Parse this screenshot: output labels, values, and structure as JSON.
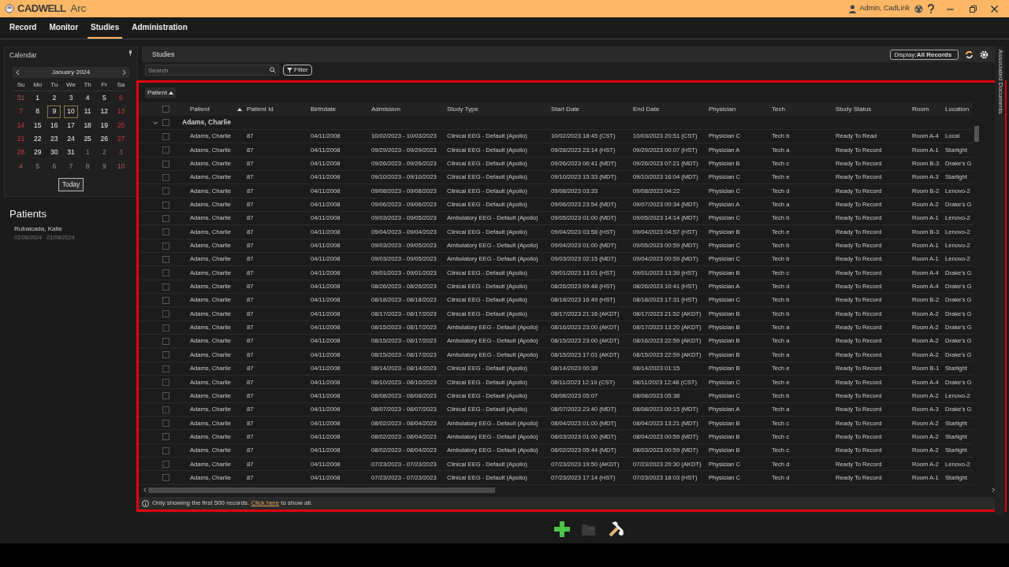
{
  "window": {
    "brand": "CADWELL",
    "product": "Arc",
    "user": "Admin, CadLink"
  },
  "menu": [
    {
      "label": "Record",
      "selected": false
    },
    {
      "label": "Monitor",
      "selected": false
    },
    {
      "label": "Studies",
      "selected": true
    },
    {
      "label": "Administration",
      "selected": false
    }
  ],
  "calendar": {
    "title": "Calendar",
    "month": "January 2024",
    "weekdays": [
      "Su",
      "Mo",
      "Tu",
      "We",
      "Th",
      "Fr",
      "Sa"
    ],
    "days": [
      {
        "d": "31",
        "in_month": false,
        "selected": false
      },
      {
        "d": "1",
        "in_month": true,
        "selected": false
      },
      {
        "d": "2",
        "in_month": true,
        "selected": false
      },
      {
        "d": "3",
        "in_month": true,
        "selected": false
      },
      {
        "d": "4",
        "in_month": true,
        "selected": false
      },
      {
        "d": "5",
        "in_month": true,
        "selected": false
      },
      {
        "d": "6",
        "in_month": true,
        "selected": false
      },
      {
        "d": "7",
        "in_month": true,
        "selected": false
      },
      {
        "d": "8",
        "in_month": true,
        "selected": false
      },
      {
        "d": "9",
        "in_month": true,
        "selected": true
      },
      {
        "d": "10",
        "in_month": true,
        "selected": true
      },
      {
        "d": "11",
        "in_month": true,
        "selected": false
      },
      {
        "d": "12",
        "in_month": true,
        "selected": false
      },
      {
        "d": "13",
        "in_month": true,
        "selected": false
      },
      {
        "d": "14",
        "in_month": true,
        "selected": false
      },
      {
        "d": "15",
        "in_month": true,
        "selected": false
      },
      {
        "d": "16",
        "in_month": true,
        "selected": false
      },
      {
        "d": "17",
        "in_month": true,
        "selected": false
      },
      {
        "d": "18",
        "in_month": true,
        "selected": false
      },
      {
        "d": "19",
        "in_month": true,
        "selected": false
      },
      {
        "d": "20",
        "in_month": true,
        "selected": false
      },
      {
        "d": "21",
        "in_month": true,
        "selected": false
      },
      {
        "d": "22",
        "in_month": true,
        "selected": false
      },
      {
        "d": "23",
        "in_month": true,
        "selected": false
      },
      {
        "d": "24",
        "in_month": true,
        "selected": false
      },
      {
        "d": "25",
        "in_month": true,
        "selected": false
      },
      {
        "d": "26",
        "in_month": true,
        "selected": false
      },
      {
        "d": "27",
        "in_month": true,
        "selected": false
      },
      {
        "d": "28",
        "in_month": true,
        "selected": false
      },
      {
        "d": "29",
        "in_month": true,
        "selected": false
      },
      {
        "d": "30",
        "in_month": true,
        "selected": false
      },
      {
        "d": "31",
        "in_month": true,
        "selected": false
      },
      {
        "d": "1",
        "in_month": false,
        "selected": false
      },
      {
        "d": "2",
        "in_month": false,
        "selected": false
      },
      {
        "d": "3",
        "in_month": false,
        "selected": false
      },
      {
        "d": "4",
        "in_month": false,
        "selected": false
      },
      {
        "d": "5",
        "in_month": false,
        "selected": false
      },
      {
        "d": "6",
        "in_month": false,
        "selected": false
      },
      {
        "d": "7",
        "in_month": false,
        "selected": false
      },
      {
        "d": "8",
        "in_month": false,
        "selected": false
      },
      {
        "d": "9",
        "in_month": false,
        "selected": false
      },
      {
        "d": "10",
        "in_month": false,
        "selected": false
      }
    ],
    "today_button": "Today"
  },
  "patients": {
    "title": "Patients",
    "items": [
      {
        "name": "Rubalcada, Katie",
        "dates": "01/09/2024 - 01/09/2024"
      }
    ]
  },
  "studies": {
    "title": "Studies",
    "search": {
      "placeholder": "Search"
    },
    "filter_button": "Filter",
    "display": {
      "label": "Display:",
      "value": "All Records"
    },
    "side_tab": "Associated Documents",
    "group_by": "Patient",
    "header_checked": false,
    "columns": [
      "Patient",
      "Patient Id",
      "Birthdate",
      "Admission",
      "Study Type",
      "Start Date",
      "End Date",
      "Physician",
      "Tech",
      "Study Status",
      "Room",
      "Location"
    ],
    "groups": [
      {
        "label": "Adams, Charlie",
        "expanded": true,
        "checked": false,
        "rows": [
          {
            "checked": false,
            "cells": [
              "Adams, Charlie",
              "87",
              "04/11/2008",
              "10/02/2023 - 10/03/2023",
              "Clinical EEG - Default (Apollo)",
              "10/02/2023 18:45 (CST)",
              "10/03/2023 20:51 (CST)",
              "Physician C",
              "Tech b",
              "Ready To Read",
              "Room A-4",
              "Local"
            ]
          },
          {
            "checked": false,
            "cells": [
              "Adams, Charlie",
              "87",
              "04/11/2008",
              "09/29/2023 - 09/29/2023",
              "Clinical EEG - Default (Apollo)",
              "09/28/2023 23:14 (HST)",
              "09/29/2023 00:07 (HST)",
              "Physician A",
              "Tech a",
              "Ready To Record",
              "Room A-1",
              "Starlight"
            ]
          },
          {
            "checked": false,
            "cells": [
              "Adams, Charlie",
              "87",
              "04/11/2008",
              "09/26/2023 - 09/26/2023",
              "Clinical EEG - Default (Apollo)",
              "09/26/2023 06:41 (MDT)",
              "09/26/2023 07:21 (MDT)",
              "Physician B",
              "Tech c",
              "Ready To Record",
              "Room B-3",
              "Drake's G"
            ]
          },
          {
            "checked": false,
            "cells": [
              "Adams, Charlie",
              "87",
              "04/11/2008",
              "09/10/2023 - 09/10/2023",
              "Clinical EEG - Default (Apollo)",
              "09/10/2023 15:33 (MDT)",
              "09/10/2023 16:04 (MDT)",
              "Physician C",
              "Tech e",
              "Ready To Record",
              "Room A-3",
              "Starlight"
            ]
          },
          {
            "checked": false,
            "cells": [
              "Adams, Charlie",
              "87",
              "04/11/2008",
              "09/08/2023 - 09/08/2023",
              "Clinical EEG - Default (Apollo)",
              "09/08/2023 03:33",
              "09/08/2023 04:22",
              "Physician C",
              "Tech d",
              "Ready To Record",
              "Room B-2",
              "Lenovo-2"
            ]
          },
          {
            "checked": false,
            "cells": [
              "Adams, Charlie",
              "87",
              "04/11/2008",
              "09/06/2023 - 09/06/2023",
              "Clinical EEG - Default (Apollo)",
              "09/06/2023 23:54 (MDT)",
              "09/07/2023 00:34 (MDT)",
              "Physician A",
              "Tech a",
              "Ready To Record",
              "Room A-2",
              "Drake's G"
            ]
          },
          {
            "checked": false,
            "cells": [
              "Adams, Charlie",
              "87",
              "04/11/2008",
              "09/03/2023 - 09/05/2023",
              "Ambulatory EEG - Default (Apollo)",
              "09/05/2023 01:00 (MDT)",
              "09/05/2023 14:14 (MDT)",
              "Physician C",
              "Tech b",
              "Ready To Record",
              "Room A-1",
              "Lenovo-2"
            ]
          },
          {
            "checked": false,
            "cells": [
              "Adams, Charlie",
              "87",
              "04/11/2008",
              "09/04/2023 - 09/04/2023",
              "Clinical EEG - Default (Apollo)",
              "09/04/2023 03:58 (HST)",
              "09/04/2023 04:57 (HST)",
              "Physician B",
              "Tech e",
              "Ready To Record",
              "Room B-3",
              "Lenovo-2"
            ]
          },
          {
            "checked": false,
            "cells": [
              "Adams, Charlie",
              "87",
              "04/11/2008",
              "09/03/2023 - 09/05/2023",
              "Ambulatory EEG - Default (Apollo)",
              "09/04/2023 01:00 (MDT)",
              "09/05/2023 00:59 (MDT)",
              "Physician C",
              "Tech b",
              "Ready To Record",
              "Room A-1",
              "Lenovo-2"
            ]
          },
          {
            "checked": false,
            "cells": [
              "Adams, Charlie",
              "87",
              "04/11/2008",
              "09/03/2023 - 09/05/2023",
              "Ambulatory EEG - Default (Apollo)",
              "09/03/2023 02:15 (MDT)",
              "09/04/2023 00:59 (MDT)",
              "Physician C",
              "Tech b",
              "Ready To Record",
              "Room A-1",
              "Lenovo-2"
            ]
          },
          {
            "checked": false,
            "cells": [
              "Adams, Charlie",
              "87",
              "04/11/2008",
              "09/01/2023 - 09/01/2023",
              "Clinical EEG - Default (Apollo)",
              "09/01/2023 13:01 (HST)",
              "09/01/2023 13:39 (HST)",
              "Physician B",
              "Tech c",
              "Ready To Record",
              "Room A-4",
              "Drake's G"
            ]
          },
          {
            "checked": false,
            "cells": [
              "Adams, Charlie",
              "87",
              "04/11/2008",
              "08/26/2023 - 08/26/2023",
              "Clinical EEG - Default (Apollo)",
              "08/26/2023 09:48 (HST)",
              "08/26/2023 10:41 (HST)",
              "Physician A",
              "Tech d",
              "Ready To Record",
              "Room A-4",
              "Drake's G"
            ]
          },
          {
            "checked": false,
            "cells": [
              "Adams, Charlie",
              "87",
              "04/11/2008",
              "08/18/2023 - 08/18/2023",
              "Clinical EEG - Default (Apollo)",
              "08/18/2023 16:49 (HST)",
              "08/18/2023 17:31 (HST)",
              "Physician C",
              "Tech b",
              "Ready To Record",
              "Room B-2",
              "Drake's G"
            ]
          },
          {
            "checked": false,
            "cells": [
              "Adams, Charlie",
              "87",
              "04/11/2008",
              "08/17/2023 - 08/17/2023",
              "Clinical EEG - Default (Apollo)",
              "08/17/2023 21:16 (AKDT)",
              "08/17/2023 21:52 (AKDT)",
              "Physician B",
              "Tech b",
              "Ready To Record",
              "Room A-2",
              "Drake's G"
            ]
          },
          {
            "checked": false,
            "cells": [
              "Adams, Charlie",
              "87",
              "04/11/2008",
              "08/15/2023 - 08/17/2023",
              "Ambulatory EEG - Default (Apollo)",
              "08/16/2023 23:00 (AKDT)",
              "08/17/2023 13:20 (AKDT)",
              "Physician B",
              "Tech a",
              "Ready To Record",
              "Room A-2",
              "Drake's G"
            ]
          },
          {
            "checked": false,
            "cells": [
              "Adams, Charlie",
              "87",
              "04/11/2008",
              "08/15/2023 - 08/17/2023",
              "Ambulatory EEG - Default (Apollo)",
              "08/15/2023 23:00 (AKDT)",
              "08/16/2023 22:59 (AKDT)",
              "Physician B",
              "Tech a",
              "Ready To Record",
              "Room A-2",
              "Drake's G"
            ]
          },
          {
            "checked": false,
            "cells": [
              "Adams, Charlie",
              "87",
              "04/11/2008",
              "08/15/2023 - 08/17/2023",
              "Ambulatory EEG - Default (Apollo)",
              "08/15/2023 17:01 (AKDT)",
              "08/15/2023 22:59 (AKDT)",
              "Physician B",
              "Tech a",
              "Ready To Record",
              "Room A-2",
              "Drake's G"
            ]
          },
          {
            "checked": false,
            "cells": [
              "Adams, Charlie",
              "87",
              "04/11/2008",
              "08/14/2023 - 08/14/2023",
              "Clinical EEG - Default (Apollo)",
              "08/14/2023 00:39",
              "08/14/2023 01:15",
              "Physician B",
              "Tech e",
              "Ready To Record",
              "Room B-1",
              "Starlight"
            ]
          },
          {
            "checked": false,
            "cells": [
              "Adams, Charlie",
              "87",
              "04/11/2008",
              "08/10/2023 - 08/10/2023",
              "Clinical EEG - Default (Apollo)",
              "08/11/2023 12:10 (CST)",
              "08/11/2023 12:48 (CST)",
              "Physician C",
              "Tech e",
              "Ready To Record",
              "Room A-4",
              "Drake's G"
            ]
          },
          {
            "checked": false,
            "cells": [
              "Adams, Charlie",
              "87",
              "04/11/2008",
              "08/08/2023 - 08/08/2023",
              "Clinical EEG - Default (Apollo)",
              "08/08/2023 05:07",
              "08/08/2023 05:38",
              "Physician C",
              "Tech b",
              "Ready To Record",
              "Room A-2",
              "Lenovo-2"
            ]
          },
          {
            "checked": false,
            "cells": [
              "Adams, Charlie",
              "87",
              "04/11/2008",
              "08/07/2023 - 08/07/2023",
              "Clinical EEG - Default (Apollo)",
              "08/07/2023 23:40 (MDT)",
              "08/08/2023 00:15 (MDT)",
              "Physician A",
              "Tech a",
              "Ready To Record",
              "Room A-3",
              "Drake's G"
            ]
          },
          {
            "checked": false,
            "cells": [
              "Adams, Charlie",
              "87",
              "04/11/2008",
              "08/02/2023 - 08/04/2023",
              "Ambulatory EEG - Default (Apollo)",
              "08/04/2023 01:00 (MDT)",
              "08/04/2023 13:21 (MDT)",
              "Physician B",
              "Tech c",
              "Ready To Record",
              "Room A-2",
              "Starlight"
            ]
          },
          {
            "checked": false,
            "cells": [
              "Adams, Charlie",
              "87",
              "04/11/2008",
              "08/02/2023 - 08/04/2023",
              "Ambulatory EEG - Default (Apollo)",
              "08/03/2023 01:00 (MDT)",
              "08/04/2023 00:59 (MDT)",
              "Physician B",
              "Tech c",
              "Ready To Record",
              "Room A-2",
              "Starlight"
            ]
          },
          {
            "checked": false,
            "cells": [
              "Adams, Charlie",
              "87",
              "04/11/2008",
              "08/02/2023 - 08/04/2023",
              "Ambulatory EEG - Default (Apollo)",
              "08/02/2023 05:44 (MDT)",
              "08/03/2023 00:59 (MDT)",
              "Physician B",
              "Tech c",
              "Ready To Record",
              "Room A-2",
              "Starlight"
            ]
          },
          {
            "checked": false,
            "cells": [
              "Adams, Charlie",
              "87",
              "04/11/2008",
              "07/23/2023 - 07/23/2023",
              "Clinical EEG - Default (Apollo)",
              "07/23/2023 19:50 (AKDT)",
              "07/23/2023 20:30 (AKDT)",
              "Physician C",
              "Tech d",
              "Ready To Record",
              "Room A-2",
              "Lenovo-2"
            ]
          },
          {
            "checked": false,
            "cells": [
              "Adams, Charlie",
              "87",
              "04/11/2008",
              "07/23/2023 - 07/23/2023",
              "Clinical EEG - Default (Apollo)",
              "07/23/2023 17:14 (HST)",
              "07/23/2023 18:03 (HST)",
              "Physician C",
              "Tech d",
              "Ready To Record",
              "Room A-1",
              "Starlight"
            ]
          }
        ]
      }
    ],
    "notice": {
      "before": "Only showing the first 500 records.",
      "link": "Click here",
      "after": "to show all."
    }
  }
}
